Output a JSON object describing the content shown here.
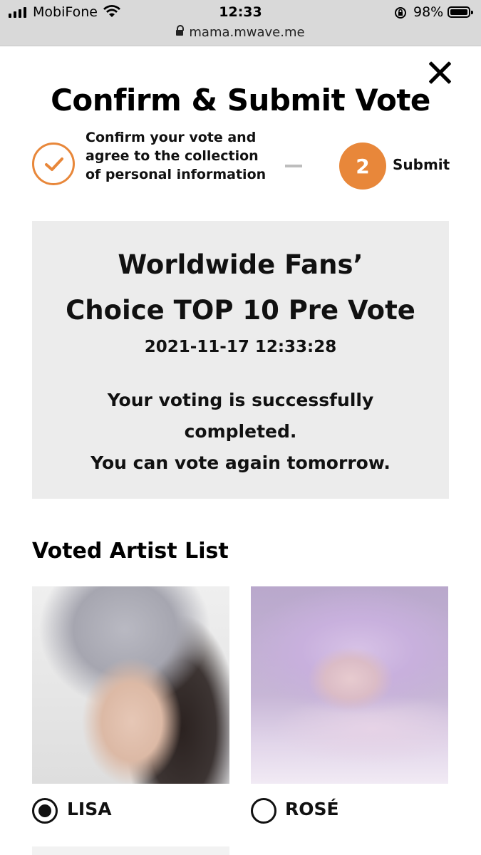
{
  "status_bar": {
    "carrier": "MobiFone",
    "time": "12:33",
    "battery": "98%",
    "battery_level": 0.98,
    "url": "mama.mwave.me"
  },
  "header": {
    "title": "Confirm & Submit Vote"
  },
  "steps": [
    {
      "label": "Confirm your vote and agree to the collection of personal information",
      "state": "done"
    },
    {
      "number": "2",
      "label": "Submit",
      "state": "active"
    }
  ],
  "result": {
    "title_line1": "Worldwide Fans’",
    "title_line2": "Choice TOP 10 Pre Vote",
    "datetime": "2021-11-17 12:33:28",
    "message_line1": "Your voting is successfully",
    "message_line2": "completed.",
    "message_line3": "You can vote again tomorrow."
  },
  "voted_list": {
    "title": "Voted Artist List",
    "artists": [
      {
        "name": "LISA",
        "selected": true
      },
      {
        "name": "ROSÉ",
        "selected": false
      }
    ]
  },
  "colors": {
    "accent": "#e8873a",
    "box_bg": "#ececec",
    "statusbar_bg": "#d9d9d9"
  }
}
